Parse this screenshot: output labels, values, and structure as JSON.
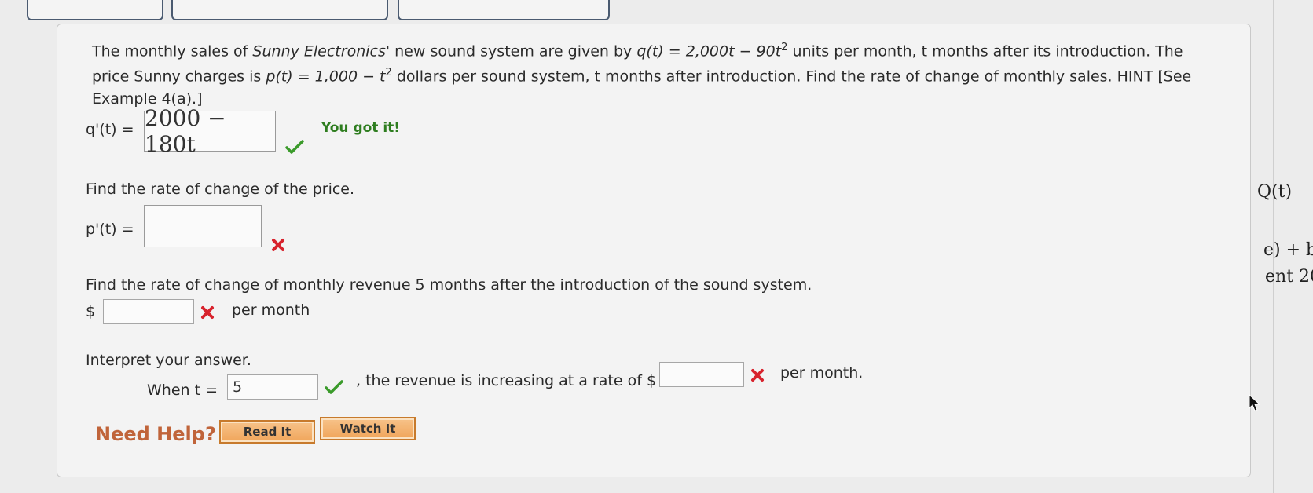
{
  "problem": {
    "intro_1": "The monthly sales of ",
    "company": "Sunny Electronics'",
    "intro_2": " new sound system are given by ",
    "q_def": "q(t) = 2,000t − 90t",
    "exp": "2",
    "intro_3": " units per month, t months after its introduction. The price Sunny charges is ",
    "p_def": "p(t) = 1,000 − t",
    "intro_4": " dollars per sound system, t months after introduction. Find the rate of change of monthly sales. HINT [See Example 4(a).]"
  },
  "part1": {
    "label": "q'(t) =",
    "answer": "2000 − 180t",
    "feedback": "You got it!"
  },
  "part2": {
    "prompt": "Find the rate of change of the price.",
    "label": "p'(t) =",
    "answer": ""
  },
  "part3": {
    "prompt": "Find the rate of change of monthly revenue 5 months after the introduction of the sound system.",
    "currency": "$",
    "answer": "",
    "unit": "per month"
  },
  "part4": {
    "prompt": "Interpret your answer.",
    "when_label": "When t =",
    "t_value": "5",
    "middle_text": ", the revenue is increasing at a rate of $",
    "answer": "",
    "unit": "per month."
  },
  "help": {
    "label": "Need Help?",
    "read_button": "Read It",
    "watch_button": "Watch It"
  },
  "side_panel": {
    "line1": "Q(t)",
    "line2": "e) + b",
    "line3": "ent 20"
  },
  "colors": {
    "correct": "#3a9a2a",
    "incorrect": "#d8222c",
    "help_label": "#c0643a",
    "button_fill": "#f0a55a"
  }
}
